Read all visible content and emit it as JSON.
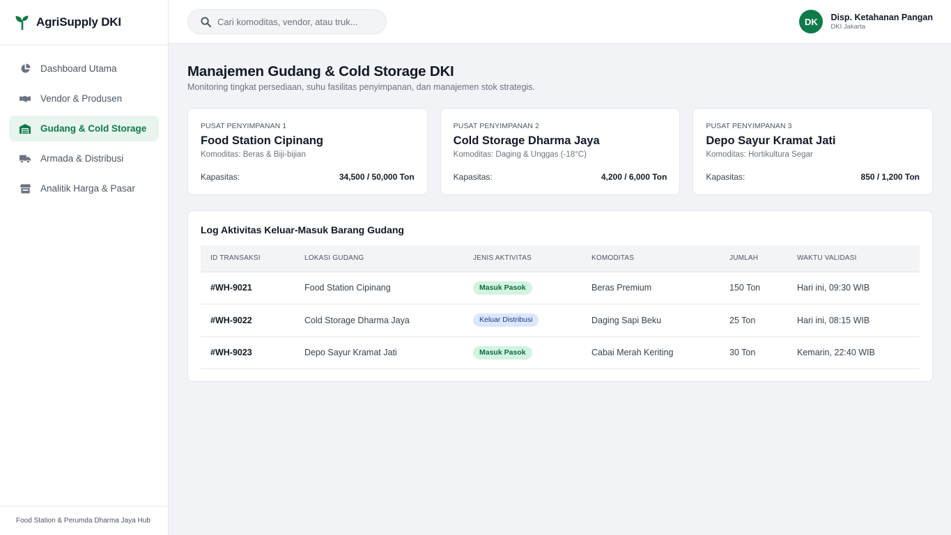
{
  "brand": {
    "name": "AgriSupply DKI",
    "accent": "#0f7a4a"
  },
  "sidebar": {
    "items": [
      {
        "label": "Dashboard Utama",
        "icon": "pie-chart-icon",
        "active": false
      },
      {
        "label": "Vendor & Produsen",
        "icon": "handshake-icon",
        "active": false
      },
      {
        "label": "Gudang & Cold Storage",
        "icon": "warehouse-icon",
        "active": true
      },
      {
        "label": "Armada & Distribusi",
        "icon": "truck-icon",
        "active": false
      },
      {
        "label": "Analitik Harga & Pasar",
        "icon": "store-icon",
        "active": false
      }
    ],
    "footer": "Food Station & Perumda Dharma Jaya Hub"
  },
  "search": {
    "placeholder": "Cari komoditas, vendor, atau truk..."
  },
  "user": {
    "initials": "DK",
    "name": "Disp. Ketahanan Pangan",
    "region": "DKI Jakarta"
  },
  "page": {
    "title": "Manajemen Gudang & Cold Storage DKI",
    "subtitle": "Monitoring tingkat persediaan, suhu fasilitas penyimpanan, dan manajemen stok strategis."
  },
  "cards": [
    {
      "kicker": "PUSAT PENYIMPANAN 1",
      "title": "Food Station Cipinang",
      "sub": "Komoditas: Beras & Biji-bijian",
      "cap_label": "Kapasitas:",
      "cap_value": "34,500 / 50,000 Ton"
    },
    {
      "kicker": "PUSAT PENYIMPANAN 2",
      "title": "Cold Storage Dharma Jaya",
      "sub": "Komoditas: Daging & Unggas (-18°C)",
      "cap_label": "Kapasitas:",
      "cap_value": "4,200 / 6,000 Ton"
    },
    {
      "kicker": "PUSAT PENYIMPANAN 3",
      "title": "Depo Sayur Kramat Jati",
      "sub": "Komoditas: Hortikultura Segar",
      "cap_label": "Kapasitas:",
      "cap_value": "850 / 1,200 Ton"
    }
  ],
  "log": {
    "title": "Log Aktivitas Keluar-Masuk Barang Gudang",
    "columns": [
      "ID TRANSAKSI",
      "LOKASI GUDANG",
      "JENIS AKTIVITAS",
      "KOMODITAS",
      "JUMLAH",
      "WAKTU VALIDASI"
    ],
    "rows": [
      {
        "id": "#WH-9021",
        "lokasi": "Food Station Cipinang",
        "jenis": "Masuk Pasok",
        "jenis_type": "in",
        "komoditas": "Beras Premium",
        "jumlah": "150 Ton",
        "waktu": "Hari ini, 09:30 WIB"
      },
      {
        "id": "#WH-9022",
        "lokasi": "Cold Storage Dharma Jaya",
        "jenis": "Keluar Distribusi",
        "jenis_type": "out",
        "komoditas": "Daging Sapi Beku",
        "jumlah": "25 Ton",
        "waktu": "Hari ini, 08:15 WIB"
      },
      {
        "id": "#WH-9023",
        "lokasi": "Depo Sayur Kramat Jati",
        "jenis": "Masuk Pasok",
        "jenis_type": "in",
        "komoditas": "Cabai Merah Keriting",
        "jumlah": "30 Ton",
        "waktu": "Kemarin, 22:40 WIB"
      }
    ]
  }
}
